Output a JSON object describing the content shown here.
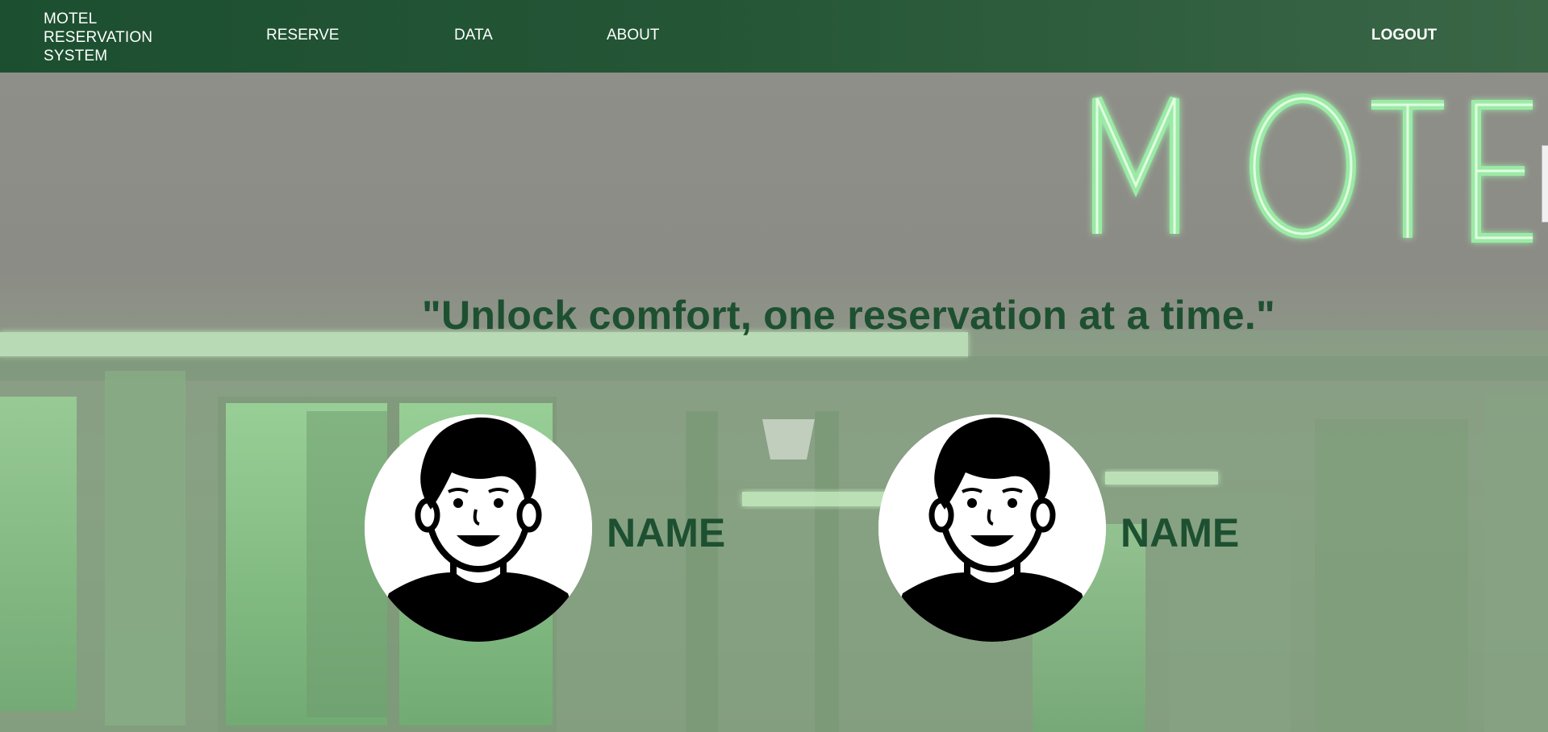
{
  "nav": {
    "brand": "MOTEL RESERVATION SYSTEM",
    "links": [
      "RESERVE",
      "DATA",
      "ABOUT"
    ],
    "logout": "LOGOUT"
  },
  "hero": {
    "sign_text": "MOTE",
    "tagline": "\"Unlock comfort, one reservation at a time.\""
  },
  "team": [
    {
      "name": "NAME",
      "avatar_icon": "person-avatar-icon"
    },
    {
      "name": "NAME",
      "avatar_icon": "person-avatar-icon"
    }
  ],
  "colors": {
    "nav_bg": "#1c4f30",
    "accent_green": "#1d5030",
    "neon_green": "#8ee89a"
  }
}
